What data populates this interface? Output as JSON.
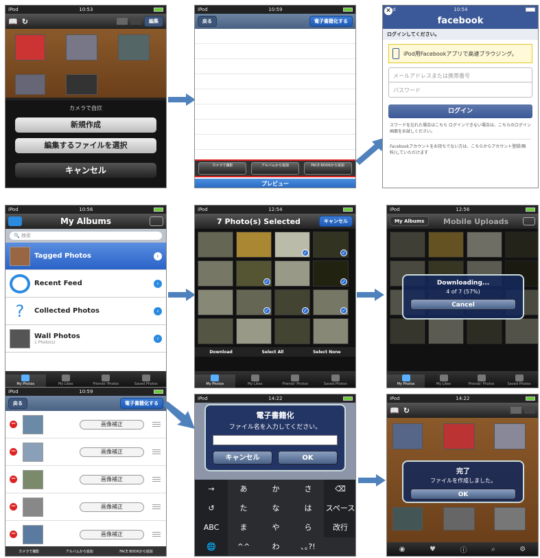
{
  "screens": {
    "s1": {
      "status": {
        "carrier": "iPod",
        "time": "10:53"
      },
      "toolbar_right": "編集",
      "sheet_title": "カメラで自炊",
      "buttons": [
        "新規作成",
        "編集するファイルを選択",
        "キャンセル"
      ]
    },
    "s2": {
      "status": {
        "carrier": "iPod",
        "time": "10:59"
      },
      "back": "戻る",
      "action": "電子書籍化する",
      "toolbar": [
        "カメラで撮影",
        "アルバムから追加",
        "FACE BOOKから追加"
      ],
      "preview": "プレビュー"
    },
    "s3": {
      "status": {
        "carrier": "iPod",
        "time": "10:54"
      },
      "title": "facebook",
      "login_prompt": "ログインしてください。",
      "app_notice": "iPod用Facebookアプリで高速ブラウジング。",
      "email_placeholder": "メールアドレスまたは携帯番号",
      "password_placeholder": "パスワード",
      "login_button": "ログイン",
      "help_text": "スワードを忘れた場合はこちら ログインできない場合は、こちらのログイン画面をお試しください。",
      "signup_text": "Facebookアカウントをお持ちでない方は、こちらからアカウント登録(無料)していただけます"
    },
    "s4": {
      "status": {
        "carrier": "iPod",
        "time": "10:56"
      },
      "title": "My Albums",
      "search_placeholder": "検索",
      "albums": [
        {
          "name": "Tagged Photos",
          "sub": ""
        },
        {
          "name": "Recent Feed",
          "sub": ""
        },
        {
          "name": "Collected Photos",
          "sub": ""
        },
        {
          "name": "Wall Photos",
          "sub": "1 Photo(s)"
        }
      ],
      "tabs": [
        "My Photos",
        "My Likes",
        "Friends' Photos",
        "Saved Photos"
      ]
    },
    "s5": {
      "status": {
        "carrier": "iPod",
        "time": "12:54"
      },
      "title": "7 Photo(s) Selected",
      "cancel": "キャンセル",
      "actions": [
        "Download",
        "Select All",
        "Select None"
      ],
      "tabs": [
        "My Photos",
        "My Likes",
        "Friends' Photos",
        "Saved Photos"
      ]
    },
    "s6": {
      "status": {
        "carrier": "iPod",
        "time": "12:56"
      },
      "back": "My Albums",
      "title": "Mobile Uploads",
      "dialog_title": "Downloading...",
      "dialog_progress": "4 of 7 (57%)",
      "progress_value": 0.57,
      "dialog_cancel": "Cancel",
      "tabs": [
        "My Photos",
        "My Likes",
        "Friends' Photos",
        "Saved Photos"
      ]
    },
    "s7": {
      "status": {
        "carrier": "iPod",
        "time": "10:59"
      },
      "back": "戻る",
      "action": "電子書籍化する",
      "edit_label": "画像補正",
      "toolbar": [
        "カメラで撮影",
        "アルバムから追加",
        "FACE BOOKから追加"
      ]
    },
    "s8": {
      "status": {
        "carrier": "iPod",
        "time": "14:22"
      },
      "dialog_title": "電子書籍化",
      "dialog_msg": "ファイル名を入力してください。",
      "cancel": "キャンセル",
      "ok": "OK",
      "keys": [
        "→",
        "あ",
        "か",
        "さ",
        "⌫",
        "↺",
        "た",
        "な",
        "は",
        "スペース",
        "ABC",
        "ま",
        "や",
        "ら",
        "改行",
        "🌐",
        "^^",
        "わ",
        "､｡?!"
      ]
    },
    "s9": {
      "status": {
        "carrier": "iPod",
        "time": "14:22"
      },
      "dialog_title": "完了",
      "dialog_msg": "ファイルを作成しました。",
      "ok": "OK"
    }
  },
  "colors": {
    "nav": "#4a6283",
    "facebook": "#3b5998",
    "highlight": "#e02020",
    "arrow": "#4f81bd"
  }
}
